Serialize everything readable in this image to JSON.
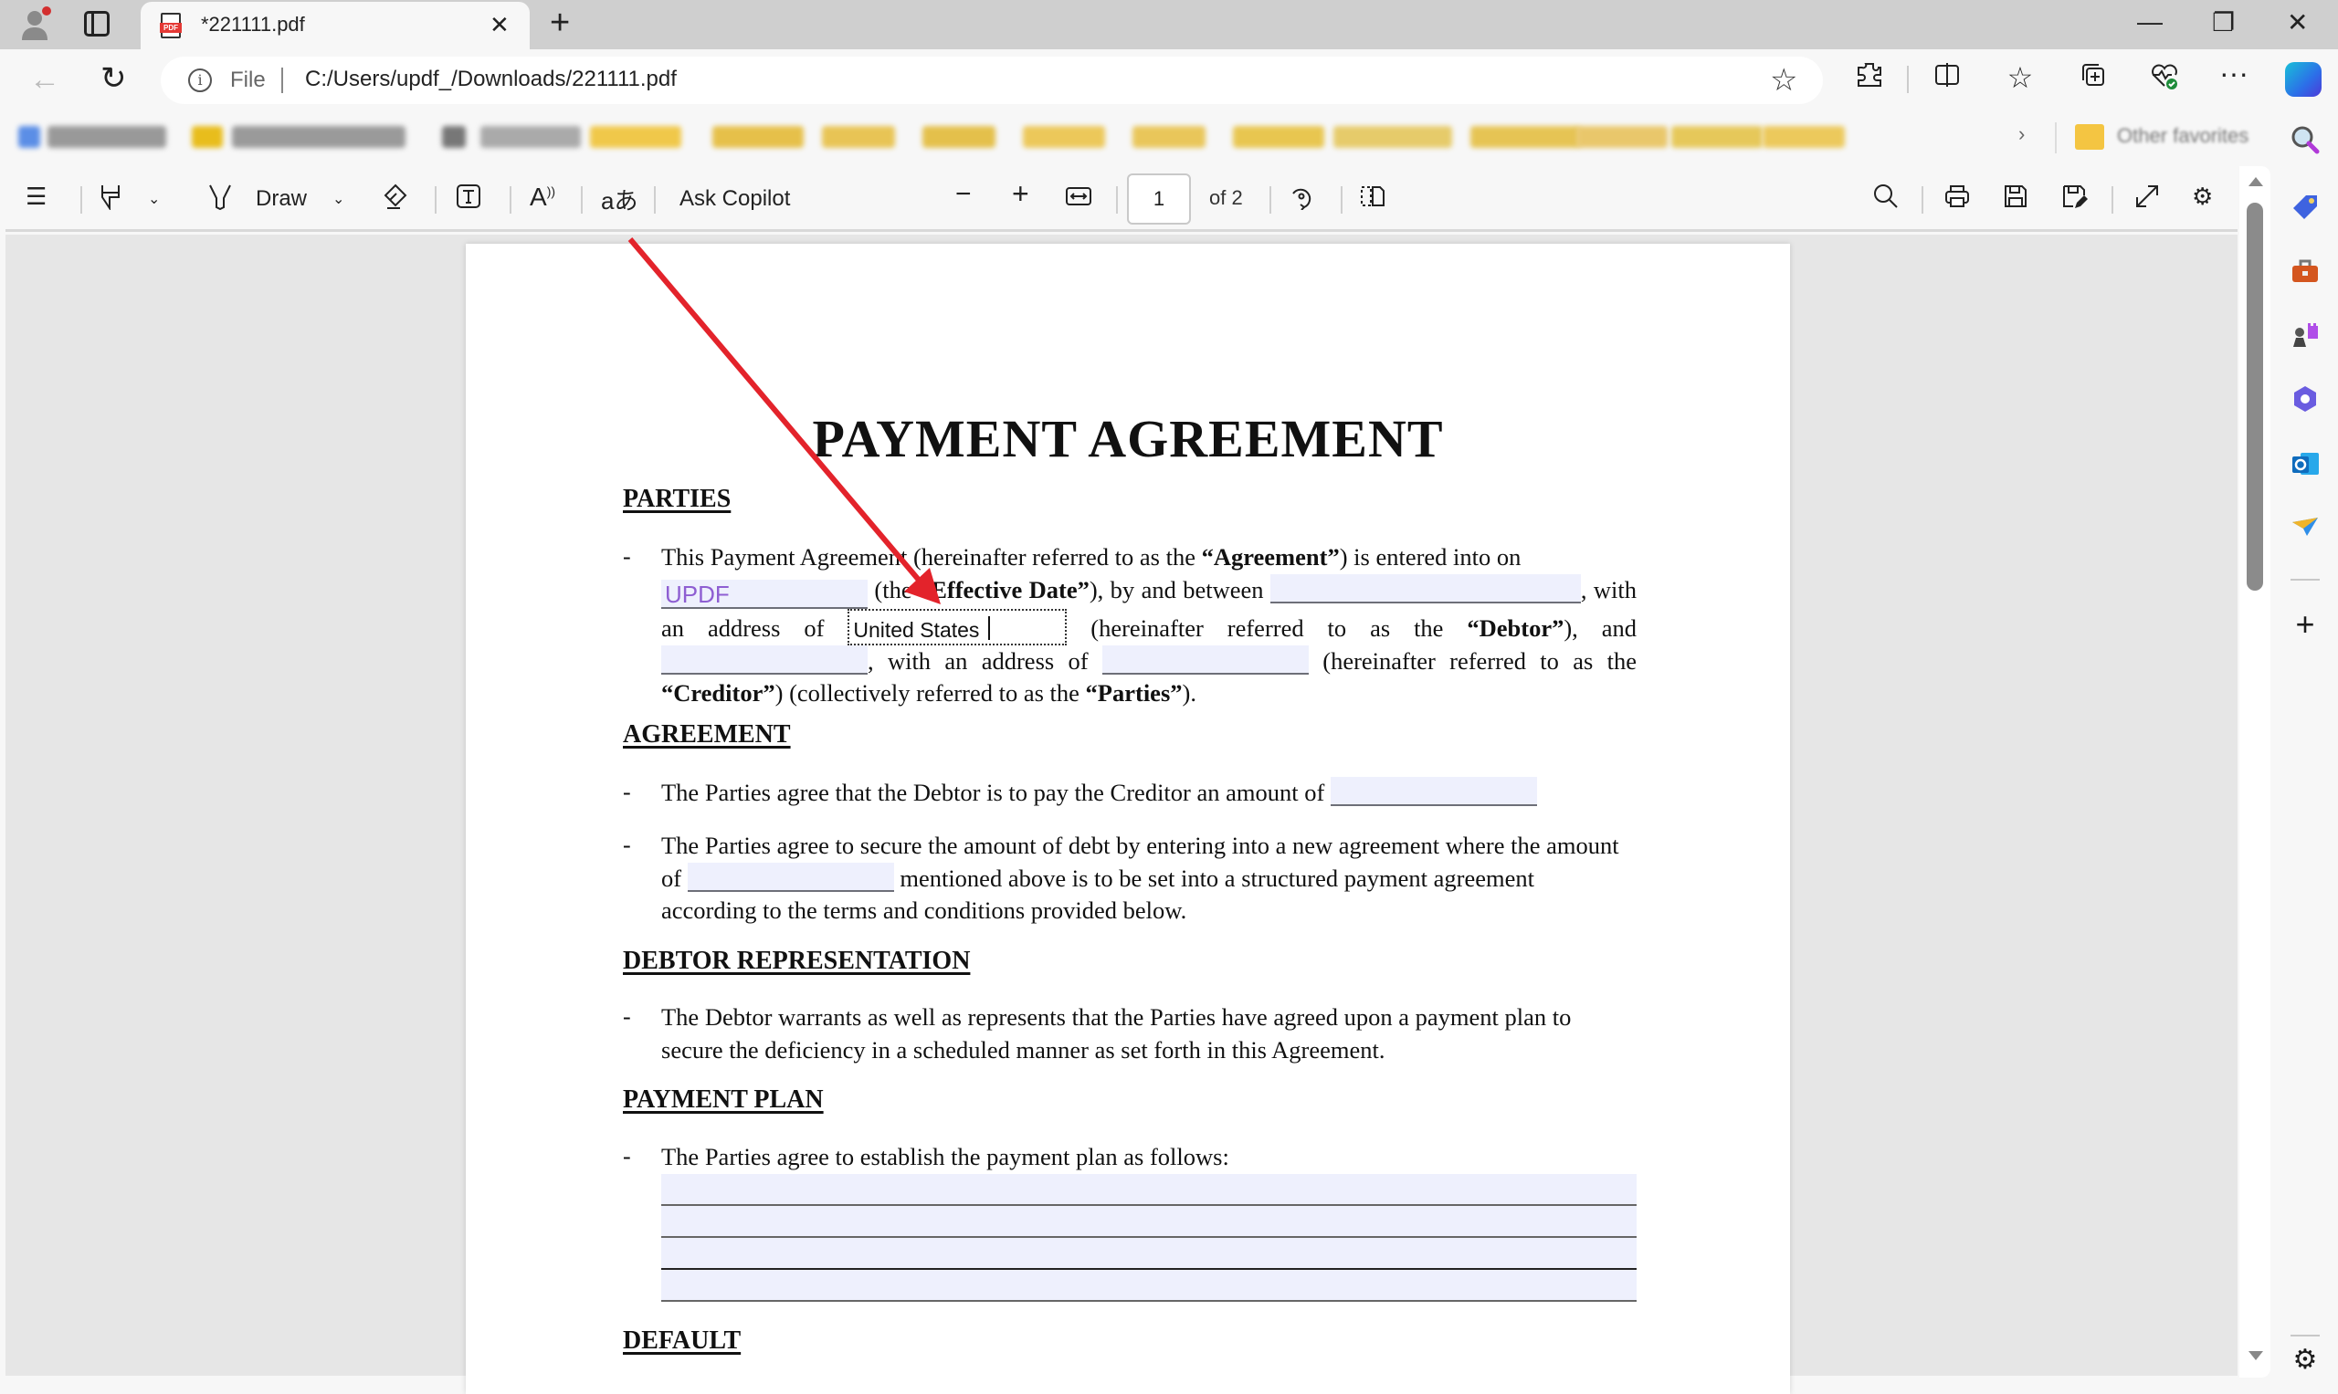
{
  "browser": {
    "tab": {
      "title": "*221111.pdf",
      "favicon_label": "PDF"
    },
    "new_tab_glyph": "+",
    "window_controls": {
      "minimize": "—",
      "restore": "❐",
      "close": "✕"
    },
    "address": {
      "scheme_label": "File",
      "url": "C:/Users/updf_/Downloads/221111.pdf"
    },
    "favorites_bar": {
      "other_favorites": "Other favorites",
      "more_glyph": "›"
    },
    "toolbar_icons": [
      "extensions-icon",
      "split-screen-icon",
      "favorites-icon",
      "collections-icon",
      "browser-essentials-icon",
      "more-icon",
      "copilot-icon"
    ],
    "sidebar_icons": [
      "search",
      "shopping-tag",
      "tools",
      "games",
      "microsoft-365",
      "outlook",
      "drop",
      "add",
      "settings"
    ]
  },
  "pdf_toolbar": {
    "draw_label": "Draw",
    "ask_copilot": "Ask Copilot",
    "page_current": "1",
    "page_total_label": "of 2"
  },
  "document": {
    "title": "PAYMENT AGREEMENT",
    "sections": {
      "parties": "PARTIES",
      "agreement": "AGREEMENT",
      "debtor": "DEBTOR REPRESENTATION",
      "plan": "PAYMENT PLAN",
      "default": "DEFAULT"
    },
    "bullet": "-",
    "parties_text": {
      "p1": "This Payment Agreement (hereinafter referred to as the ",
      "b1": "“Agreement”",
      "p2": ") is entered into on ",
      "p3": " (the ",
      "b2": "“Effective Date”",
      "p4": "), by and between ",
      "p5": ", with an address of ",
      "p6": " (hereinafter referred to as the ",
      "b3": "“Debtor”",
      "p7": "), and ",
      "p8": ", with an address of ",
      "p9": " (hereinafter referred to as the ",
      "b4": "“Creditor”",
      "p10": ") (collectively referred to as the ",
      "b5": "“Parties”",
      "p11": ")."
    },
    "fields": {
      "effective_date": "UPDF",
      "debtor_address": "United States"
    },
    "agreement_1": "The Parties agree that the Debtor is to pay the Creditor an amount of ",
    "agreement_2a": "The Parties agree to secure the amount of debt by entering into a new agreement where the amount of ",
    "agreement_2b": " mentioned above is to be set into a structured payment agreement according to the terms and conditions provided below.",
    "debtor_rep": "The Debtor warrants as well as represents that the Parties have agreed upon a payment plan to secure the deficiency in a scheduled manner as set forth in this Agreement.",
    "plan_intro": "The Parties agree to establish the payment plan as follows:"
  },
  "annotation": {
    "arrow_color": "#e3232b"
  }
}
